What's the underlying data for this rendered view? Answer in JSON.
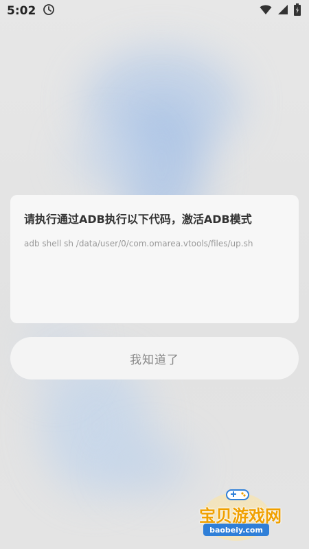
{
  "status_bar": {
    "time": "5:02"
  },
  "dialog": {
    "title": "请执行通过ADB执行以下代码，激活ADB模式",
    "command": "adb shell sh /data/user/0/com.omarea.vtools/files/up.sh"
  },
  "ok_button": {
    "label": "我知道了"
  },
  "watermark": {
    "text": "宝贝游戏网",
    "url": "baobeiy.com"
  },
  "colors": {
    "dialog_bg": "#f7f7f7",
    "button_text": "#888888",
    "watermark_orange": "#f0a000",
    "watermark_blue": "#2f7fd8"
  }
}
